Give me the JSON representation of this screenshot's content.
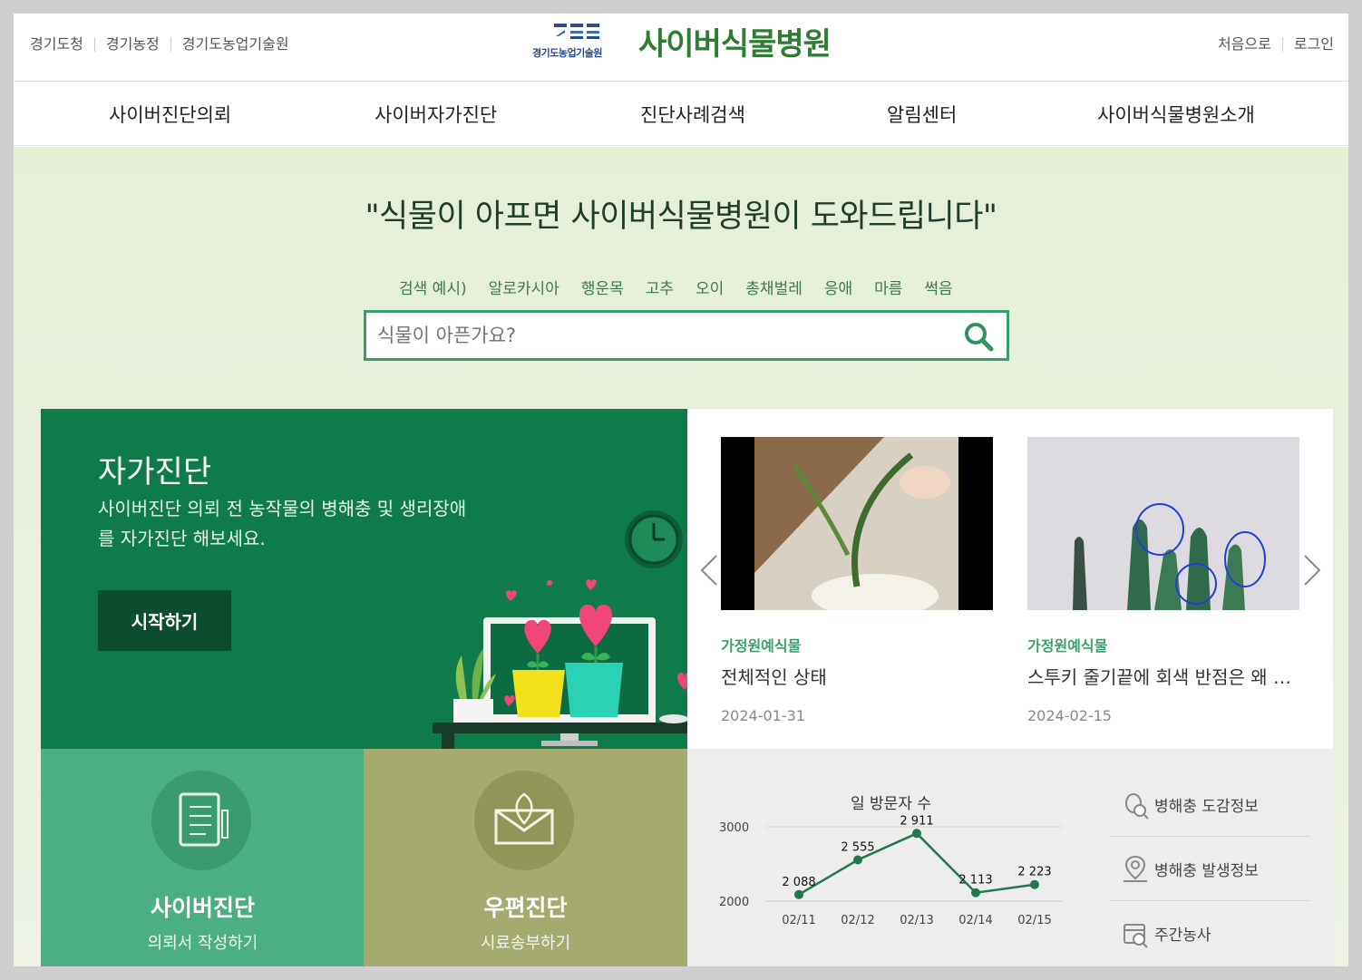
{
  "util_left": [
    "경기도청",
    "경기농정",
    "경기도농업기술원"
  ],
  "util_right": [
    "처음으로",
    "로그인"
  ],
  "logo": {
    "sub": "경기도농업기술원",
    "title": "사이버식물병원"
  },
  "nav": [
    "사이버진단의뢰",
    "사이버자가진단",
    "진단사례검색",
    "알림센터",
    "사이버식물병원소개"
  ],
  "hero_title": "\"식물이 아프면 사이버식물병원이 도와드립니다\"",
  "search": {
    "examples_label": "검색 예시)",
    "examples": [
      "알로카시아",
      "행운목",
      "고추",
      "오이",
      "총채벌레",
      "응애",
      "마름",
      "썩음"
    ],
    "placeholder": "식물이 아픈가요?"
  },
  "self_diag": {
    "title": "자가진단",
    "desc": "사이버진단 의뢰 전 농작물의 병해충 및 생리장애를 자가진단 해보세요.",
    "button": "시작하기"
  },
  "cases": [
    {
      "category": "가정원예식물",
      "title": "전체적인 상태",
      "date": "2024-01-31"
    },
    {
      "category": "가정원예식물",
      "title": "스투키 줄기끝에 회색 반점은 왜 생기나요?",
      "date": "2024-02-15"
    }
  ],
  "tiles": [
    {
      "title": "사이버진단",
      "sub": "의뢰서 작성하기",
      "color": "#4caf83"
    },
    {
      "title": "우편진단",
      "sub": "시료송부하기",
      "color": "#a5ab6e"
    }
  ],
  "chart_data": {
    "type": "line",
    "title": "일 방문자 수",
    "categories": [
      "02/11",
      "02/12",
      "02/13",
      "02/14",
      "02/15"
    ],
    "values": [
      2088,
      2555,
      2911,
      2113,
      2223
    ],
    "data_labels": [
      "2 088",
      "2 555",
      "2 911",
      "2 113",
      "2 223"
    ],
    "ylim": [
      2000,
      3000
    ],
    "yticks": [
      "2000",
      "3000"
    ],
    "color": "#1e7a4c"
  },
  "quick_links": [
    "병해충 도감정보",
    "병해충 발생정보",
    "주간농사"
  ]
}
